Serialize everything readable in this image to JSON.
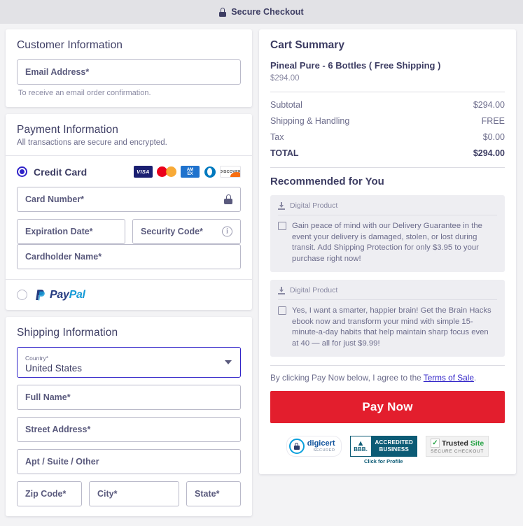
{
  "header": {
    "title": "Secure Checkout",
    "lock_icon": "lock-icon"
  },
  "customer": {
    "title": "Customer Information",
    "email_placeholder": "Email Address*",
    "help": "To receive an email order confirmation."
  },
  "payment": {
    "title": "Payment Information",
    "subtitle": "All transactions are secure and encrypted.",
    "credit_card_label": "Credit Card",
    "brands": [
      {
        "name": "visa-logo",
        "label": "VISA"
      },
      {
        "name": "mastercard-logo",
        "label": ""
      },
      {
        "name": "amex-logo",
        "label_top": "AM",
        "label_bottom": "EX"
      },
      {
        "name": "diners-club-logo",
        "label": ""
      },
      {
        "name": "discover-logo",
        "label": "DISCOVER"
      }
    ],
    "card_number_placeholder": "Card Number*",
    "expiration_placeholder": "Expiration Date*",
    "security_code_placeholder": "Security Code*",
    "cardholder_placeholder": "Cardholder Name*",
    "paypal_label_a": "Pay",
    "paypal_label_b": "Pal"
  },
  "shipping": {
    "title": "Shipping Information",
    "country_label": "Country*",
    "country_value": "United States",
    "full_name_placeholder": "Full Name*",
    "street_placeholder": "Street Address*",
    "apt_placeholder": "Apt / Suite / Other",
    "zip_placeholder": "Zip Code*",
    "city_placeholder": "City*",
    "state_placeholder": "State*"
  },
  "cart": {
    "title": "Cart Summary",
    "product_name": "Pineal Pure - 6 Bottles ( Free Shipping )",
    "product_price": "$294.00",
    "lines": [
      {
        "label": "Subtotal",
        "value": "$294.00"
      },
      {
        "label": "Shipping & Handling",
        "value": "FREE"
      },
      {
        "label": "Tax",
        "value": "$0.00"
      }
    ],
    "total_label": "TOTAL",
    "total_value": "$294.00"
  },
  "recommended": {
    "title": "Recommended for You",
    "items": [
      {
        "tag": "Digital Product",
        "text": "Gain peace of mind with our Delivery Guarantee in the event your delivery is damaged, stolen, or lost during transit. Add Shipping Protection for only $3.95 to your purchase right now!"
      },
      {
        "tag": "Digital Product",
        "text": "Yes, I want a smarter, happier brain! Get the Brain Hacks ebook now and transform your mind with simple 15-minute-a-day habits that help maintain sharp focus even at 40 — all for just $9.99!"
      }
    ]
  },
  "checkout": {
    "terms_prefix": "By clicking Pay Now below, I agree to the ",
    "terms_link": "Terms of Sale",
    "terms_suffix": ".",
    "pay_button": "Pay Now"
  },
  "badges": {
    "digicert_name": "digicert",
    "digicert_sub": "SECURED",
    "bbb_abbr": "BBB.",
    "bbb_line1": "ACCREDITED",
    "bbb_line2": "BUSINESS",
    "bbb_click": "Click for Profile",
    "trusted_name1": "Trusted",
    "trusted_name2": "Site",
    "trusted_sub": "SECURE CHECKOUT"
  },
  "colors": {
    "accent_blue": "#3023c8",
    "pay_red": "#e31e2d",
    "text": "#3d3d63",
    "page_bg": "#f3f3f5"
  }
}
